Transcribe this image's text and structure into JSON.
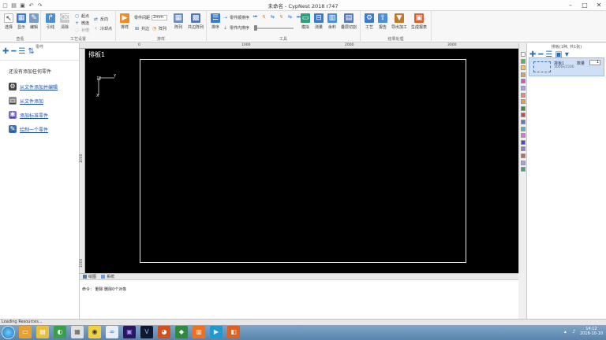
{
  "window": {
    "title": "未命名 - CypNest 2018 r747"
  },
  "ribbon": {
    "groups": [
      {
        "label": "查看"
      },
      {
        "label": "工艺设置"
      },
      {
        "label": "排样"
      },
      {
        "label": "工具"
      },
      {
        "label": "结果处理"
      }
    ],
    "view": {
      "select": "选择",
      "display": "显示",
      "edit": "编辑"
    },
    "process": {
      "lead": "引线",
      "clear": "清除",
      "start_point": "起点",
      "micro_joint": "微连",
      "compensation": "补偿",
      "reverse": "反向",
      "sort": "排序",
      "micro_point": "冷却点"
    },
    "nest": {
      "nest": "排样",
      "spacing_label": "零件间距",
      "spacing_value": "2mm",
      "common_edge": "共边",
      "fill": "阵列",
      "array": "阵列",
      "common_array": "共边阵列"
    },
    "tools": {
      "layout": "排序",
      "part_rotate_cw": "零件顺排序",
      "part_inner_sort": "零件内排序",
      "simulate": "模拟",
      "measure": "测量",
      "material": "余料",
      "overlap_cut": "叠层切割"
    },
    "result": {
      "process": "工艺",
      "report": "报告",
      "export": "导出加工",
      "gen_report": "生成报表"
    }
  },
  "left_panel": {
    "header": "零件",
    "empty_message": "还没有添加任何零件",
    "actions": [
      {
        "label": "从文件添加并编辑",
        "icon": "gears-icon"
      },
      {
        "label": "从文件添加",
        "icon": "file-icon"
      },
      {
        "label": "添加标准零件",
        "icon": "puzzle-icon"
      },
      {
        "label": "绘制一个零件",
        "icon": "draw-icon"
      }
    ]
  },
  "canvas": {
    "board_label": "排板1",
    "ruler_h": [
      "0",
      "1000",
      "2000",
      "3000"
    ],
    "ruler_v": [
      "1000",
      "2000",
      "1000"
    ],
    "axis_x": "X",
    "axis_y": "Y"
  },
  "bottom_tabs": [
    {
      "label": "绘图"
    },
    {
      "label": "系统"
    }
  ],
  "command": {
    "text": "命令： 删除   删除0个对象"
  },
  "colors": [
    "#ffffff",
    "#4cbe4c",
    "#f2c84b",
    "#d2a36b",
    "#d14fc9",
    "#9f9ff0",
    "#f08080",
    "#e0a050",
    "#3d8a3d",
    "#c64b4b",
    "#4d7ccc",
    "#60b0b0",
    "#e070e0",
    "#4848c8",
    "#9080c0",
    "#b07060",
    "#a0a0f0",
    "#40a080"
  ],
  "right_panel": {
    "header": "排板(1种, 共1张)",
    "list_head": "",
    "board_name": "排板1",
    "board_size": "3000x1500",
    "count_label": "数量",
    "count_value": "1"
  },
  "statusbar": {
    "text": "Loading Resources..."
  },
  "taskbar": {
    "time": "14:12",
    "date": "2018-10-10"
  }
}
